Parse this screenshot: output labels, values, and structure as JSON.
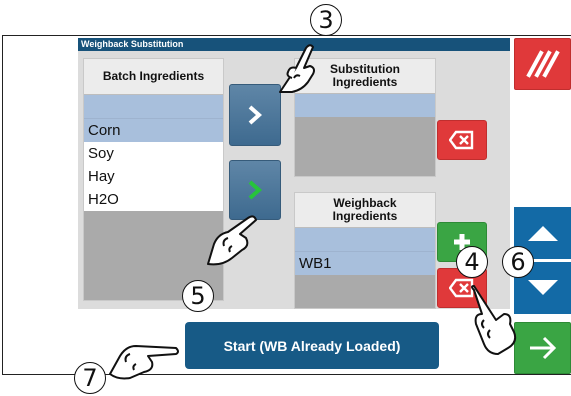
{
  "window": {
    "title": "Weighback Substitution"
  },
  "batch_ingredients": {
    "header": "Batch Ingredients",
    "items": [
      "",
      "Corn",
      "Soy",
      "Hay",
      "H2O"
    ]
  },
  "substitution_ingredients": {
    "header": "Substitution Ingredients",
    "items": [
      ""
    ]
  },
  "weighback_ingredients": {
    "header": "Weighback Ingredients",
    "items": [
      "",
      "WB1"
    ]
  },
  "start_button": {
    "label": "Start (WB Already Loaded)"
  },
  "callouts": [
    "3",
    "4",
    "5",
    "6",
    "7"
  ],
  "colors": {
    "title_bar": "#17527a",
    "selected_row": "#a8bfdc",
    "red": "#e0393a",
    "green": "#3aa544",
    "blue": "#136aa6"
  },
  "icons": {
    "move_to_substitution": "chevron-right-white-icon",
    "move_to_weighback": "chevron-right-green-icon",
    "clear_substitution": "backspace-x-icon",
    "add_weighback": "plus-icon",
    "remove_weighback": "backspace-x-icon",
    "cancel": "slashes-icon",
    "scroll_up": "triangle-up-icon",
    "scroll_down": "triangle-down-icon",
    "enter": "arrow-into-icon"
  }
}
